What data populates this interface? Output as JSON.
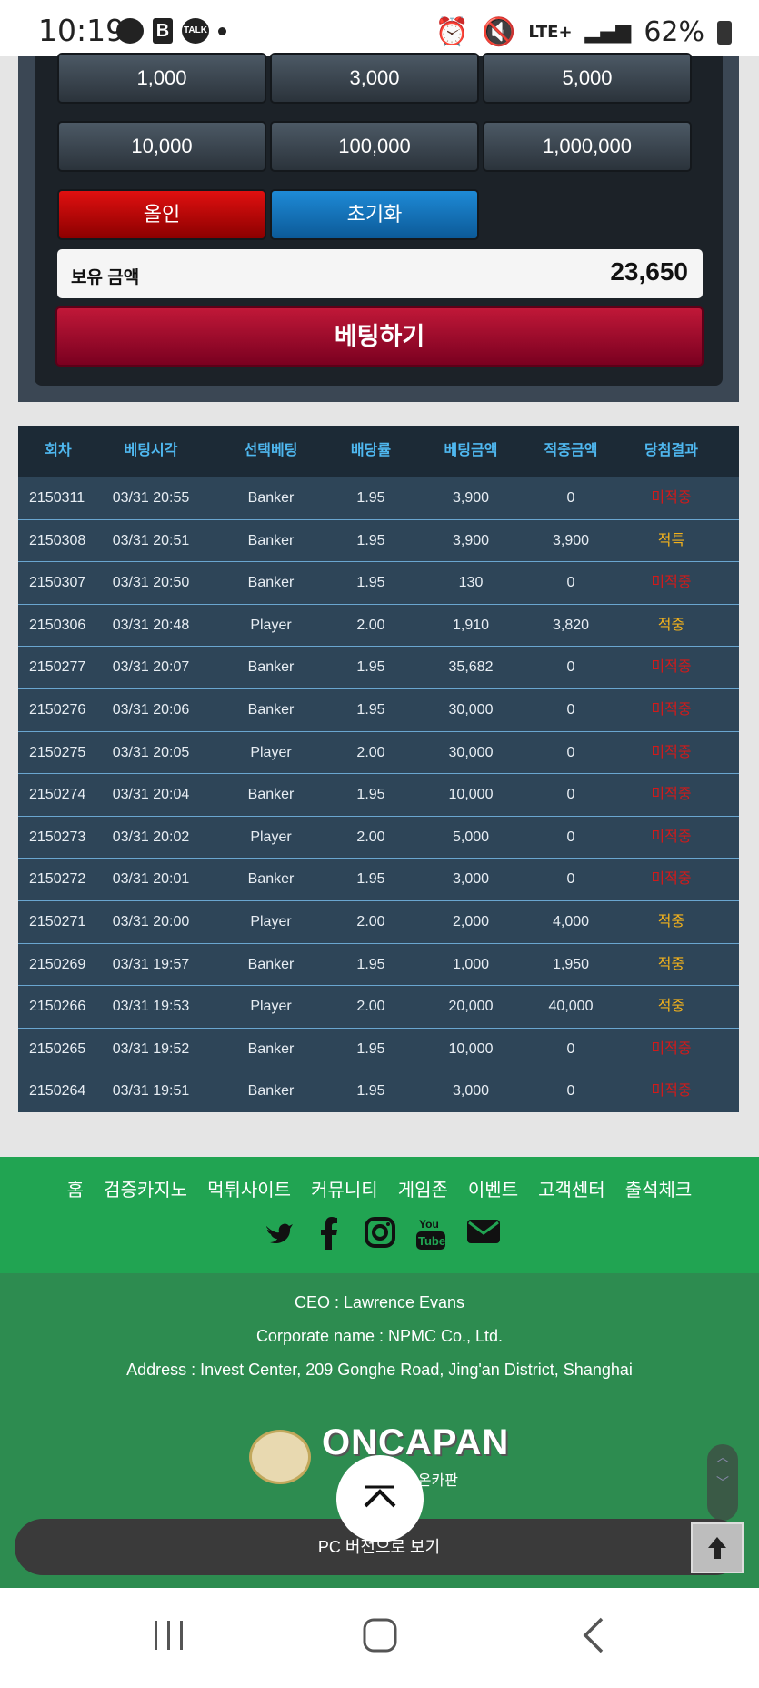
{
  "status_bar": {
    "time": "10:19",
    "left_icons": [
      "chat-icon",
      "b-icon",
      "talk-icon",
      "dot-icon"
    ],
    "talk_label": "TALK",
    "b_label": "B",
    "network": "LTE+",
    "battery": "62%"
  },
  "bet_panel": {
    "chips_row1": [
      "1,000",
      "3,000",
      "5,000"
    ],
    "chips_row2": [
      "10,000",
      "100,000",
      "1,000,000"
    ],
    "allin_label": "올인",
    "reset_label": "초기화",
    "balance_label": "보유 금액",
    "balance_value": "23,650",
    "bet_button_label": "베팅하기"
  },
  "history_table": {
    "headers": [
      "회차",
      "베팅시각",
      "선택베팅",
      "배당률",
      "베팅금액",
      "적중금액",
      "당첨결과"
    ],
    "rows": [
      {
        "round": "2150311",
        "time": "03/31 20:55",
        "pick": "Banker",
        "odds": "1.95",
        "amount": "3,900",
        "won": "0",
        "result": "미적중"
      },
      {
        "round": "2150308",
        "time": "03/31 20:51",
        "pick": "Banker",
        "odds": "1.95",
        "amount": "3,900",
        "won": "3,900",
        "result": "적특"
      },
      {
        "round": "2150307",
        "time": "03/31 20:50",
        "pick": "Banker",
        "odds": "1.95",
        "amount": "130",
        "won": "0",
        "result": "미적중"
      },
      {
        "round": "2150306",
        "time": "03/31 20:48",
        "pick": "Player",
        "odds": "2.00",
        "amount": "1,910",
        "won": "3,820",
        "result": "적중"
      },
      {
        "round": "2150277",
        "time": "03/31 20:07",
        "pick": "Banker",
        "odds": "1.95",
        "amount": "35,682",
        "won": "0",
        "result": "미적중"
      },
      {
        "round": "2150276",
        "time": "03/31 20:06",
        "pick": "Banker",
        "odds": "1.95",
        "amount": "30,000",
        "won": "0",
        "result": "미적중"
      },
      {
        "round": "2150275",
        "time": "03/31 20:05",
        "pick": "Player",
        "odds": "2.00",
        "amount": "30,000",
        "won": "0",
        "result": "미적중"
      },
      {
        "round": "2150274",
        "time": "03/31 20:04",
        "pick": "Banker",
        "odds": "1.95",
        "amount": "10,000",
        "won": "0",
        "result": "미적중"
      },
      {
        "round": "2150273",
        "time": "03/31 20:02",
        "pick": "Player",
        "odds": "2.00",
        "amount": "5,000",
        "won": "0",
        "result": "미적중"
      },
      {
        "round": "2150272",
        "time": "03/31 20:01",
        "pick": "Banker",
        "odds": "1.95",
        "amount": "3,000",
        "won": "0",
        "result": "미적중"
      },
      {
        "round": "2150271",
        "time": "03/31 20:00",
        "pick": "Player",
        "odds": "2.00",
        "amount": "2,000",
        "won": "4,000",
        "result": "적중"
      },
      {
        "round": "2150269",
        "time": "03/31 19:57",
        "pick": "Banker",
        "odds": "1.95",
        "amount": "1,000",
        "won": "1,950",
        "result": "적중"
      },
      {
        "round": "2150266",
        "time": "03/31 19:53",
        "pick": "Player",
        "odds": "2.00",
        "amount": "20,000",
        "won": "40,000",
        "result": "적중"
      },
      {
        "round": "2150265",
        "time": "03/31 19:52",
        "pick": "Banker",
        "odds": "1.95",
        "amount": "10,000",
        "won": "0",
        "result": "미적중"
      },
      {
        "round": "2150264",
        "time": "03/31 19:51",
        "pick": "Banker",
        "odds": "1.95",
        "amount": "3,000",
        "won": "0",
        "result": "미적중"
      }
    ]
  },
  "footer": {
    "nav_links": [
      "홈",
      "검증카지노",
      "먹튀사이트",
      "커뮤니티",
      "게임존",
      "이벤트",
      "고객센터",
      "출석체크"
    ],
    "social": [
      "twitter-icon",
      "facebook-icon",
      "instagram-icon",
      "youtube-icon",
      "mail-icon"
    ],
    "ceo": "CEO : Lawrence Evans",
    "corporate": "Corporate name : NPMC Co., Ltd.",
    "address": "Address : Invest Center, 209 Gonghe Road, Jing'an District, Shanghai",
    "logo_name": "ONCAPAN",
    "logo_tag": "NO.1 온카판",
    "pc_version": "PC 버전으로 보기",
    "colors": {
      "green_nav": "#21a452",
      "green_info": "#2d8c50",
      "win": "#f3b21c",
      "lose": "#d11a1a"
    }
  }
}
